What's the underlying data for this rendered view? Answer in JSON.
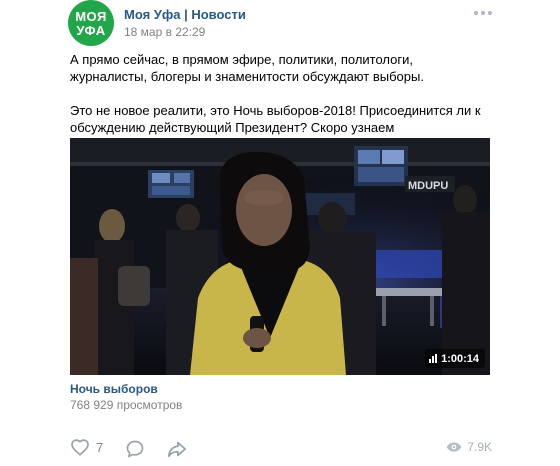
{
  "post": {
    "author": "Моя Уфа | Новости",
    "date": "18 мар в 22:29",
    "avatar": {
      "line1": "МОЯ",
      "line2": "УФА",
      "color": "#22a64a"
    },
    "text_paragraph_1": "А прямо сейчас, в прямом эфире, политики, политологи, журналисты, блогеры и знаменитости обсуждают выборы.",
    "text_paragraph_2": "Это не новое реалити, это Ночь выборов-2018! Присоединится ли к обсуждению действующий Президент? Скоро узнаем"
  },
  "video": {
    "duration": "1:00:14",
    "title": "Ночь выборов",
    "views": "768 929 просмотров",
    "background_sign": "MDUPU"
  },
  "footer": {
    "likes": "7",
    "views": "7.9K",
    "icons": [
      "heart-icon",
      "comment-icon",
      "share-icon",
      "eye-icon"
    ]
  },
  "colors": {
    "link": "#2a5885",
    "muted": "#828282",
    "icon": "#99a2ad"
  }
}
